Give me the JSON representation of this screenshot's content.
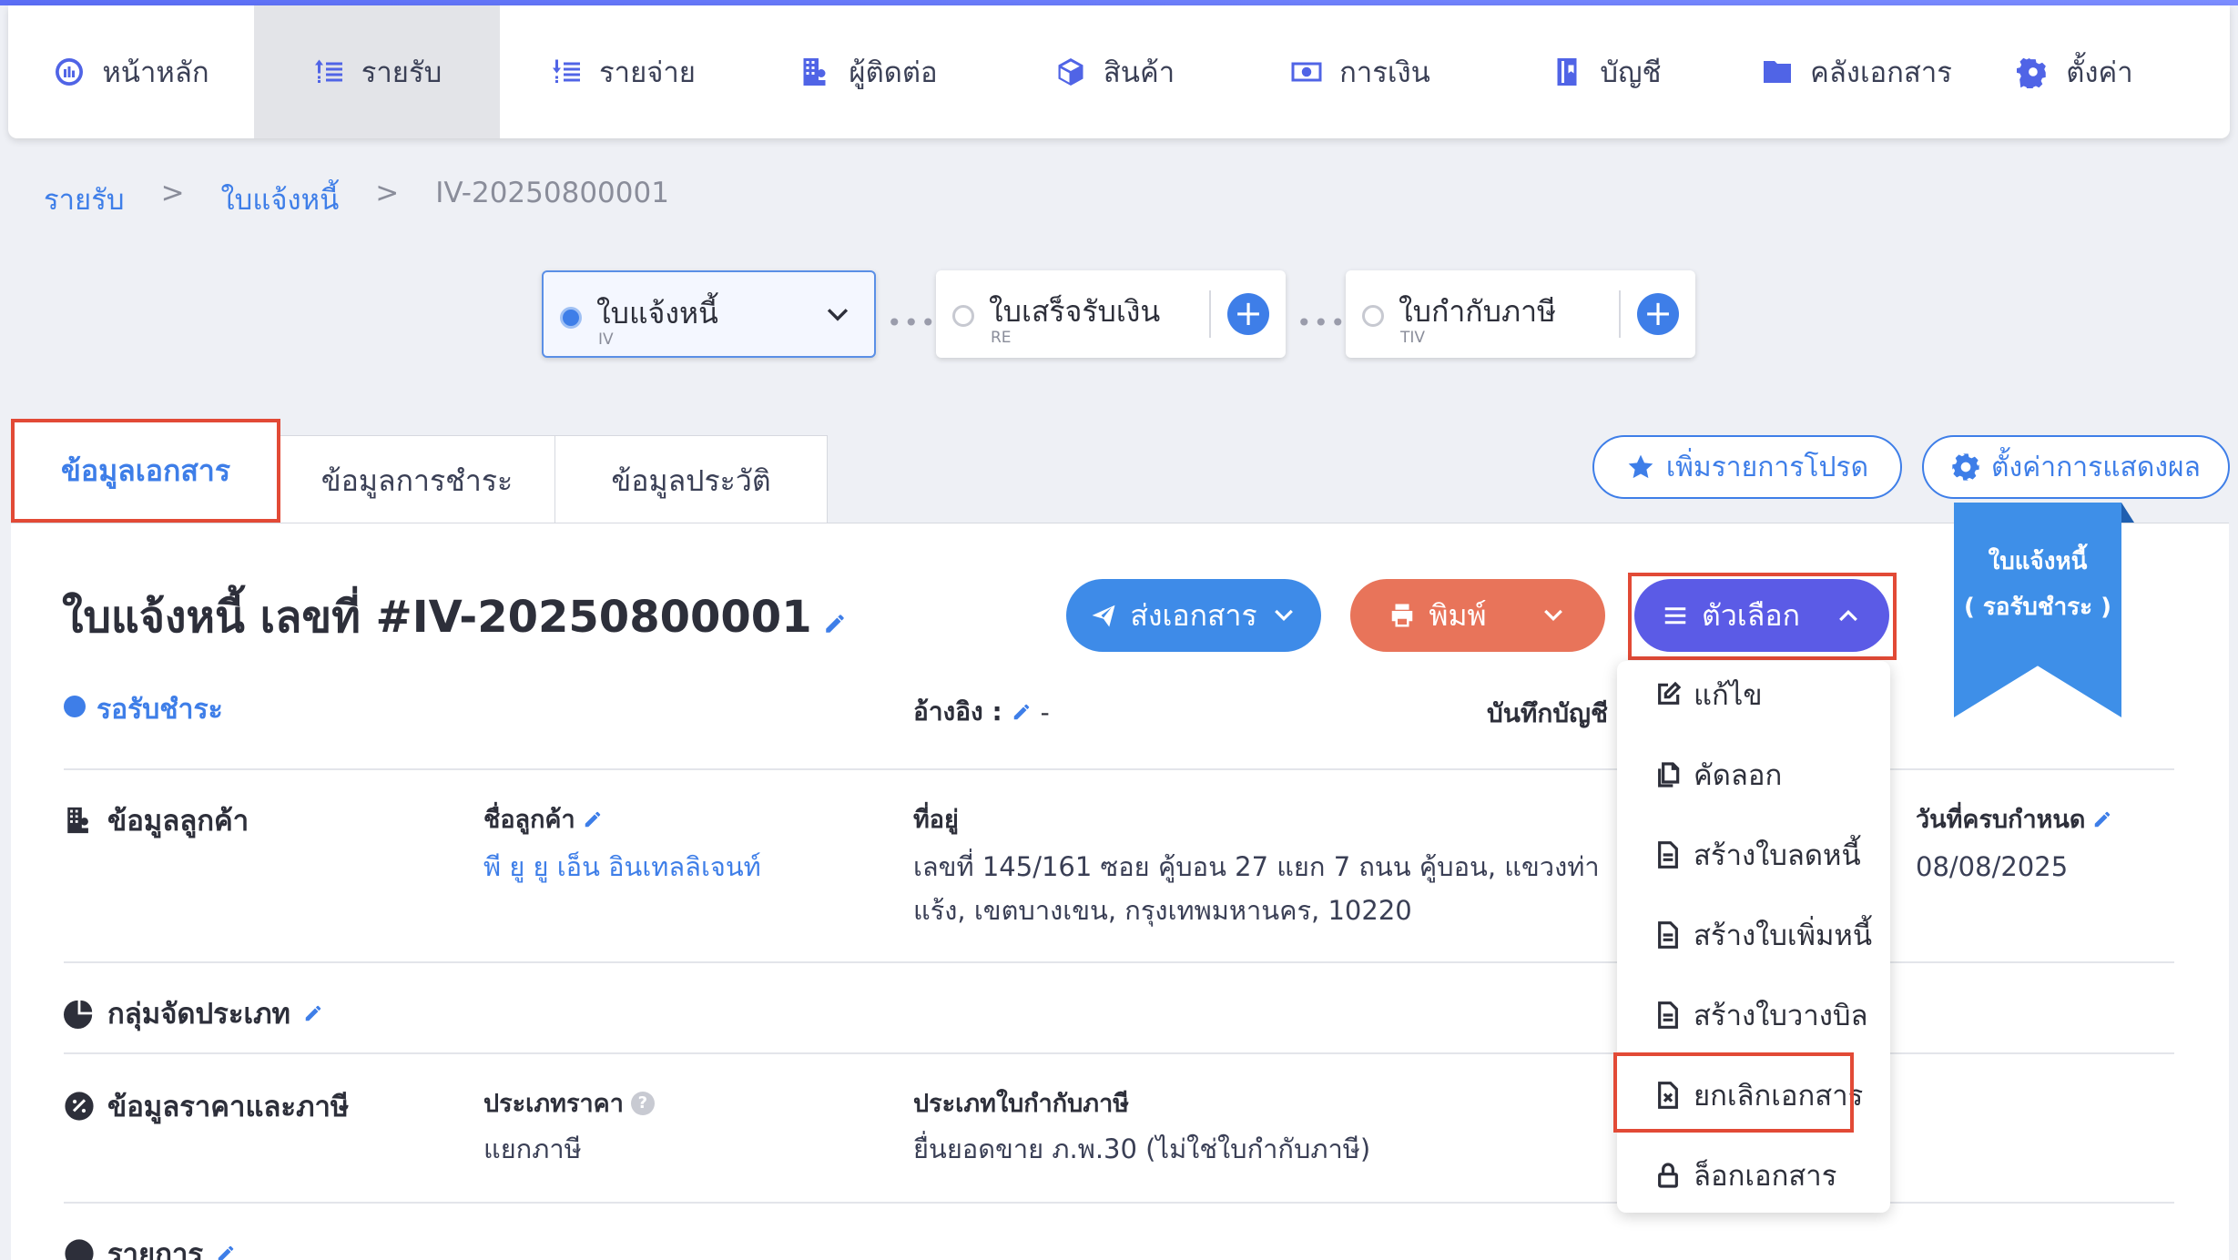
{
  "nav": [
    {
      "label": "หน้าหลัก",
      "icon": "dashboard-icon"
    },
    {
      "label": "รายรับ",
      "icon": "income-icon"
    },
    {
      "label": "รายจ่าย",
      "icon": "expense-icon"
    },
    {
      "label": "ผู้ติดต่อ",
      "icon": "contacts-icon"
    },
    {
      "label": "สินค้า",
      "icon": "product-box-icon"
    },
    {
      "label": "การเงิน",
      "icon": "money-icon"
    },
    {
      "label": "บัญชี",
      "icon": "ledger-icon"
    },
    {
      "label": "คลังเอกสาร",
      "icon": "folder-icon"
    },
    {
      "label": "ตั้งค่า",
      "icon": "gear-icon"
    }
  ],
  "breadcrumb": {
    "sep": ">",
    "items": [
      "รายรับ",
      "ใบแจ้งหนี้",
      "IV-20250800001"
    ]
  },
  "steps": [
    {
      "label": "ใบแจ้งหนี้",
      "sub": "IV"
    },
    {
      "label": "ใบเสร็จรับเงิน",
      "sub": "RE"
    },
    {
      "label": "ใบกำกับภาษี",
      "sub": "TIV"
    }
  ],
  "tabs": [
    "ข้อมูลเอกสาร",
    "ข้อมูลการชำระ",
    "ข้อมูลประวัติ"
  ],
  "buttons": {
    "favorite": "เพิ่มรายการโปรด",
    "display_settings": "ตั้งค่าการแสดงผล",
    "send": "ส่งเอกสาร",
    "print": "พิมพ์",
    "options": "ตัวเลือก"
  },
  "ribbon": {
    "line1": "ใบแจ้งหนี้",
    "line2": "( รอรับชำระ )"
  },
  "document": {
    "title": "ใบแจ้งหนี้ เลขที่ #IV-20250800001",
    "status": "รอรับชำระ",
    "reference_label": "อ้างอิง :",
    "reference_value": "-",
    "account_label": "บันทึกบัญชี :"
  },
  "customer": {
    "section": "ข้อมูลลูกค้า",
    "name_label": "ชื่อลูกค้า",
    "name": "พี ยู ยู เอ็น อินเทลลิเจนท์",
    "address_label": "ที่อยู่",
    "address_line1": "เลขที่ 145/161 ซอย คู้บอน 27 แยก 7 ถนน คู้บอน, แขวงท่า",
    "address_line2": "แร้ง, เขตบางเขน, กรุงเทพมหานคร, 10220",
    "due_label": "วันที่ครบกำหนด",
    "due_date": "08/08/2025"
  },
  "category": {
    "section": "กลุ่มจัดประเภท"
  },
  "pricing": {
    "section": "ข้อมูลราคาและภาษี",
    "price_type_label": "ประเภทราคา",
    "price_type": "แยกภาษี",
    "tax_type_label": "ประเภทใบกำกับภาษี",
    "tax_type": "ยื่นยอดขาย ภ.พ.30 (ไม่ใช่ใบกำกับภาษี)"
  },
  "items": {
    "section": "รายการ"
  },
  "options_menu": [
    "แก้ไข",
    "คัดลอก",
    "สร้างใบลดหนี้",
    "สร้างใบเพิ่มหนี้",
    "สร้างใบวางบิล",
    "ยกเลิกเอกสาร",
    "ล็อกเอกสาร"
  ],
  "colors": {
    "accent": "#3e7ee8",
    "print": "#e8745a",
    "options": "#5b5be6",
    "highlight": "#e24a36"
  }
}
